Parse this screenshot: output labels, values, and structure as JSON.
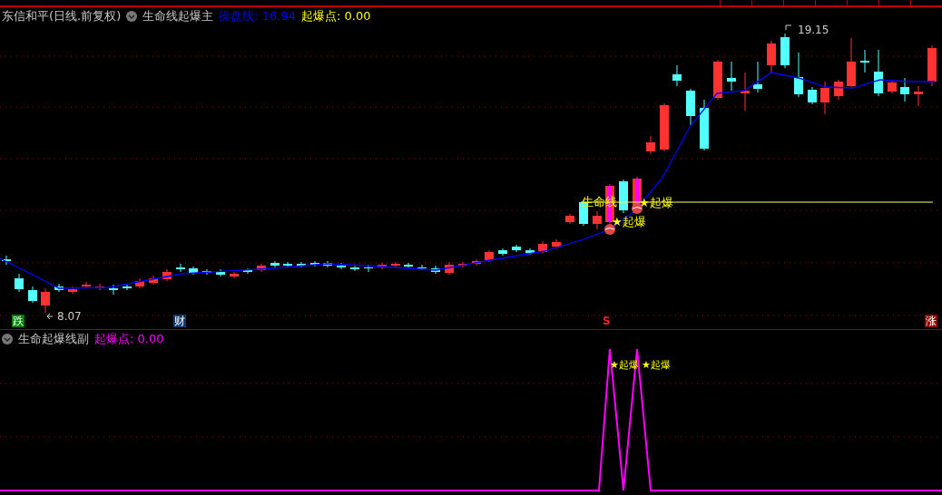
{
  "main_panel": {
    "title": "东信和平(日线.前复权)",
    "indicator": "生命线起爆主",
    "legend": [
      {
        "text": "操盘线: 16.94",
        "color": "#0000ff"
      },
      {
        "text": "起爆点: 0.00",
        "color": "#ffff00"
      }
    ],
    "high_label": "19.15",
    "low_label": "8.07",
    "line_label": "生命线",
    "signals": [
      "★起爆",
      "★起爆"
    ],
    "markers": [
      {
        "kind": "down",
        "text": "跌"
      },
      {
        "kind": "finance",
        "text": "财"
      },
      {
        "kind": "sell",
        "text": "S"
      },
      {
        "kind": "up",
        "text": "涨"
      }
    ]
  },
  "sub_panel": {
    "indicator": "生命起爆线副",
    "legend": [
      {
        "text": "起爆点: 0.00",
        "color": "#ff00ff"
      }
    ],
    "signals": [
      "★起爆",
      "★起爆"
    ]
  }
}
